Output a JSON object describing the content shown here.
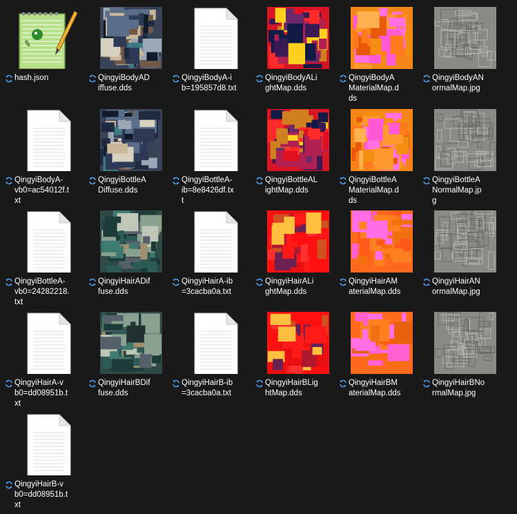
{
  "window": {
    "type": "file-explorer-icon-view"
  },
  "colors": {
    "background": "#191919",
    "label": "#ffffff",
    "sync": "#4ea6ff"
  },
  "files": [
    {
      "kind": "notepad",
      "lines": [
        "hash.json"
      ]
    },
    {
      "kind": "diffuse",
      "lines": [
        "QingyiBodyAD",
        "iffuse.dds"
      ]
    },
    {
      "kind": "text",
      "lines": [
        "QingyiBodyA-i",
        "b=195857d8.txt"
      ]
    },
    {
      "kind": "lightmap",
      "lines": [
        "QingyiBodyALi",
        "ghtMap.dds"
      ]
    },
    {
      "kind": "material",
      "lines": [
        "QingyiBodyA",
        "MaterialMap.d",
        "ds"
      ]
    },
    {
      "kind": "normal",
      "lines": [
        "QingyiBodyAN",
        "ormalMap.jpg"
      ]
    },
    {
      "kind": "text",
      "lines": [
        "QingyiBodyA-",
        "vb0=ac54012f.t",
        "xt"
      ]
    },
    {
      "kind": "diffuse",
      "lines": [
        "QingyiBottleA",
        "Diffuse.dds"
      ]
    },
    {
      "kind": "text",
      "lines": [
        "QingyiBottleA-",
        "ib=8e8426df.tx",
        "t"
      ]
    },
    {
      "kind": "lightmap",
      "lines": [
        "QingyiBottleAL",
        "ightMap.dds"
      ]
    },
    {
      "kind": "material",
      "lines": [
        "QingyiBottleA",
        "MaterialMap.d",
        "ds"
      ]
    },
    {
      "kind": "normal",
      "lines": [
        "QingyiBottleA",
        "NormalMap.jp",
        "g"
      ]
    },
    {
      "kind": "text",
      "lines": [
        "QingyiBottleA-",
        "vb0=24282218.",
        "txt"
      ]
    },
    {
      "kind": "diffuse-hair",
      "lines": [
        "QingyiHairADif",
        "fuse.dds"
      ]
    },
    {
      "kind": "text",
      "lines": [
        "QingyiHairA-ib",
        "=3cacba0a.txt"
      ]
    },
    {
      "kind": "lightmap-hair",
      "lines": [
        "QingyiHairALi",
        "ghtMap.dds"
      ]
    },
    {
      "kind": "material-hair",
      "lines": [
        "QingyiHairAM",
        "aterialMap.dds"
      ]
    },
    {
      "kind": "normal-hair",
      "lines": [
        "QingyiHairAN",
        "ormalMap.jpg"
      ]
    },
    {
      "kind": "text",
      "lines": [
        "QingyiHairA-v",
        "b0=dd08951b.t",
        "xt"
      ]
    },
    {
      "kind": "diffuse-hair",
      "lines": [
        "QingyiHairBDif",
        "fuse.dds"
      ]
    },
    {
      "kind": "text",
      "lines": [
        "QingyiHairB-ib",
        "=3cacba0a.txt"
      ]
    },
    {
      "kind": "lightmap-hair",
      "lines": [
        "QingyiHairBLig",
        "htMap.dds"
      ]
    },
    {
      "kind": "material-hair",
      "lines": [
        "QingyiHairBM",
        "aterialMap.dds"
      ]
    },
    {
      "kind": "normal-hair",
      "lines": [
        "QingyiHairBNo",
        "rmalMap.jpg"
      ]
    },
    {
      "kind": "text",
      "lines": [
        "QingyiHairB-v",
        "b0=dd08951b.t",
        "xt"
      ]
    }
  ]
}
